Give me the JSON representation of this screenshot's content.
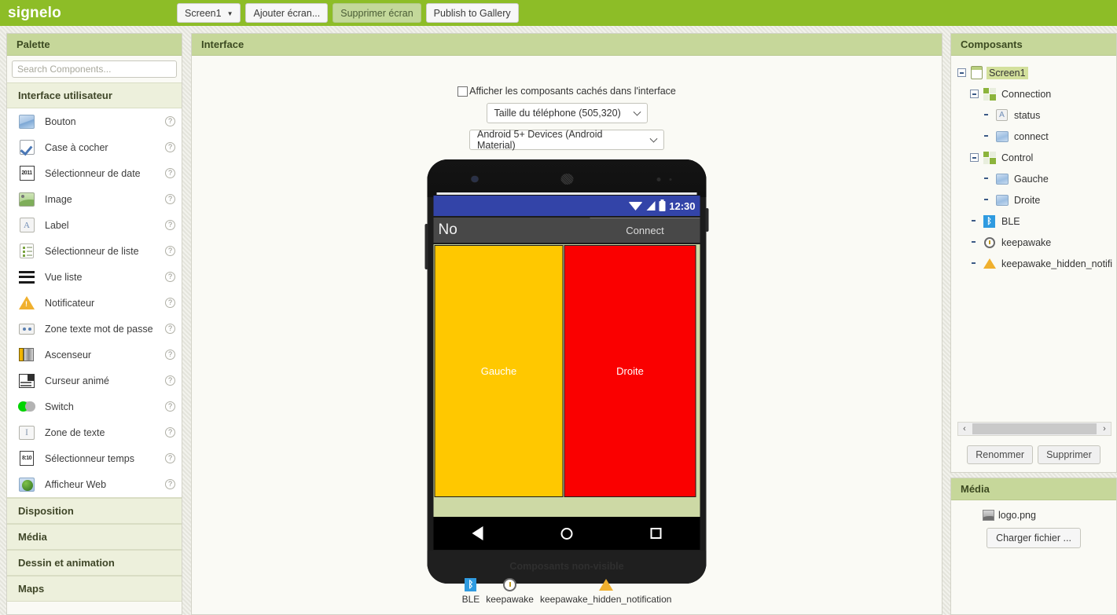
{
  "topbar": {
    "brand": "signelo",
    "screen_select": "Screen1",
    "add_screen": "Ajouter écran...",
    "remove_screen": "Supprimer écran",
    "publish": "Publish to Gallery"
  },
  "palette": {
    "title": "Palette",
    "search_placeholder": "Search Components...",
    "category": "Interface utilisateur",
    "items": [
      {
        "label": "Bouton",
        "icon": "button-icon"
      },
      {
        "label": "Case à cocher",
        "icon": "checkbox-icon"
      },
      {
        "label": "Sélectionneur de date",
        "icon": "datepicker-icon"
      },
      {
        "label": "Image",
        "icon": "image-icon"
      },
      {
        "label": "Label",
        "icon": "label-icon"
      },
      {
        "label": "Sélectionneur de liste",
        "icon": "listpicker-icon"
      },
      {
        "label": "Vue liste",
        "icon": "listview-icon"
      },
      {
        "label": "Notificateur",
        "icon": "notifier-icon"
      },
      {
        "label": "Zone texte mot de passe",
        "icon": "password-textbox-icon"
      },
      {
        "label": "Ascenseur",
        "icon": "slider-icon"
      },
      {
        "label": "Curseur animé",
        "icon": "spinner-icon"
      },
      {
        "label": "Switch",
        "icon": "switch-icon"
      },
      {
        "label": "Zone de texte",
        "icon": "textbox-icon"
      },
      {
        "label": "Sélectionneur temps",
        "icon": "timepicker-icon"
      },
      {
        "label": "Afficheur Web",
        "icon": "webviewer-icon"
      }
    ],
    "help_glyph": "?",
    "collapsed_categories": [
      "Disposition",
      "Média",
      "Dessin et animation",
      "Maps"
    ]
  },
  "viewer": {
    "title": "Interface",
    "show_hidden_label": "Afficher les composants cachés dans l'interface",
    "size_select": "Taille du téléphone (505,320)",
    "theme_select": "Android 5+ Devices (Android Material)",
    "phone": {
      "status_time": "12:30",
      "title_status_text": "No",
      "connect_label": "Connect",
      "button_left": "Gauche",
      "button_right": "Droite",
      "colors": {
        "status_bar": "#3344a8",
        "title_bar": "#484848",
        "screen_bg": "#cdd9a5",
        "button_left": "#ffc800",
        "button_right": "#fa0000"
      }
    },
    "non_visible_title": "Composants non-visible",
    "non_visible": [
      {
        "label": "BLE",
        "icon": "bluetooth-icon"
      },
      {
        "label": "keepawake",
        "icon": "clock-icon"
      },
      {
        "label": "keepawake_hidden_notification",
        "icon": "notifier-warning-icon"
      }
    ]
  },
  "components": {
    "title": "Composants",
    "tree": [
      {
        "label": "Screen1",
        "icon": "screen-icon",
        "depth": 0,
        "expander": true,
        "selected": true
      },
      {
        "label": "Connection",
        "icon": "arrangement-icon",
        "depth": 1,
        "expander": true,
        "selected": false
      },
      {
        "label": "status",
        "icon": "label-icon",
        "depth": 2,
        "expander": false,
        "selected": false
      },
      {
        "label": "connect",
        "icon": "button-icon",
        "depth": 2,
        "expander": false,
        "selected": false
      },
      {
        "label": "Control",
        "icon": "arrangement-icon",
        "depth": 1,
        "expander": true,
        "selected": false
      },
      {
        "label": "Gauche",
        "icon": "button-icon",
        "depth": 2,
        "expander": false,
        "selected": false
      },
      {
        "label": "Droite",
        "icon": "button-icon",
        "depth": 2,
        "expander": false,
        "selected": false
      },
      {
        "label": "BLE",
        "icon": "bluetooth-icon",
        "depth": 1,
        "expander": false,
        "selected": false
      },
      {
        "label": "keepawake",
        "icon": "clock-icon",
        "depth": 1,
        "expander": false,
        "selected": false
      },
      {
        "label": "keepawake_hidden_notifi",
        "icon": "notifier-warning-icon",
        "depth": 1,
        "expander": false,
        "selected": false
      }
    ],
    "rename_label": "Renommer",
    "delete_label": "Supprimer",
    "scroll_left_glyph": "‹",
    "scroll_right_glyph": "›"
  },
  "media": {
    "title": "Média",
    "files": [
      "logo.png"
    ],
    "upload_label": "Charger fichier ..."
  }
}
